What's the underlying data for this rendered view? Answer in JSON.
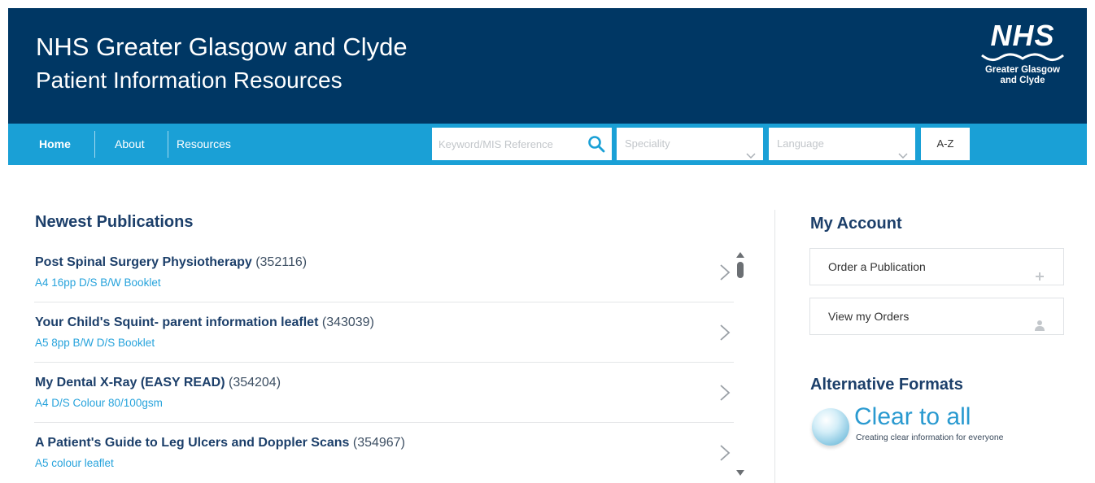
{
  "header": {
    "title": "NHS Greater Glasgow and Clyde",
    "subtitle": "Patient Information Resources",
    "logo": {
      "wordmark": "NHS",
      "line1": "Greater Glasgow",
      "line2": "and Clyde",
      "bg_color": "#003764"
    }
  },
  "nav": {
    "items": [
      {
        "label": "Home",
        "active": true
      },
      {
        "label": "About"
      },
      {
        "label": "Resources"
      }
    ],
    "search": {
      "placeholder": "Keyword/MIS Reference",
      "value": "",
      "icon": "search-icon"
    },
    "speciality": {
      "placeholder": "Speciality"
    },
    "language": {
      "placeholder": "Language"
    },
    "az_label": "A-Z",
    "bar_color": "#1aa0d6"
  },
  "newest": {
    "title": "Newest Publications",
    "items": [
      {
        "title": "Post Spinal Surgery Physiotherapy",
        "ref": "(352116)",
        "detail": "A4 16pp D/S B/W Booklet"
      },
      {
        "title": "Your Child's Squint- parent information leaflet",
        "ref": "(343039)",
        "detail": "A5 8pp B/W D/S Booklet"
      },
      {
        "title": "My Dental X-Ray (EASY READ)",
        "ref": "(354204)",
        "detail": "A4 D/S Colour 80/100gsm"
      },
      {
        "title": "A Patient's Guide to Leg Ulcers and Doppler Scans",
        "ref": "(354967)",
        "detail": "A5 colour leaflet"
      }
    ]
  },
  "account": {
    "title": "My Account",
    "order_label": "Order a Publication",
    "orders_label": "View my Orders"
  },
  "alt_formats": {
    "title": "Alternative Formats",
    "brand": "Clear to all",
    "tagline": "Creating clear information for everyone"
  }
}
